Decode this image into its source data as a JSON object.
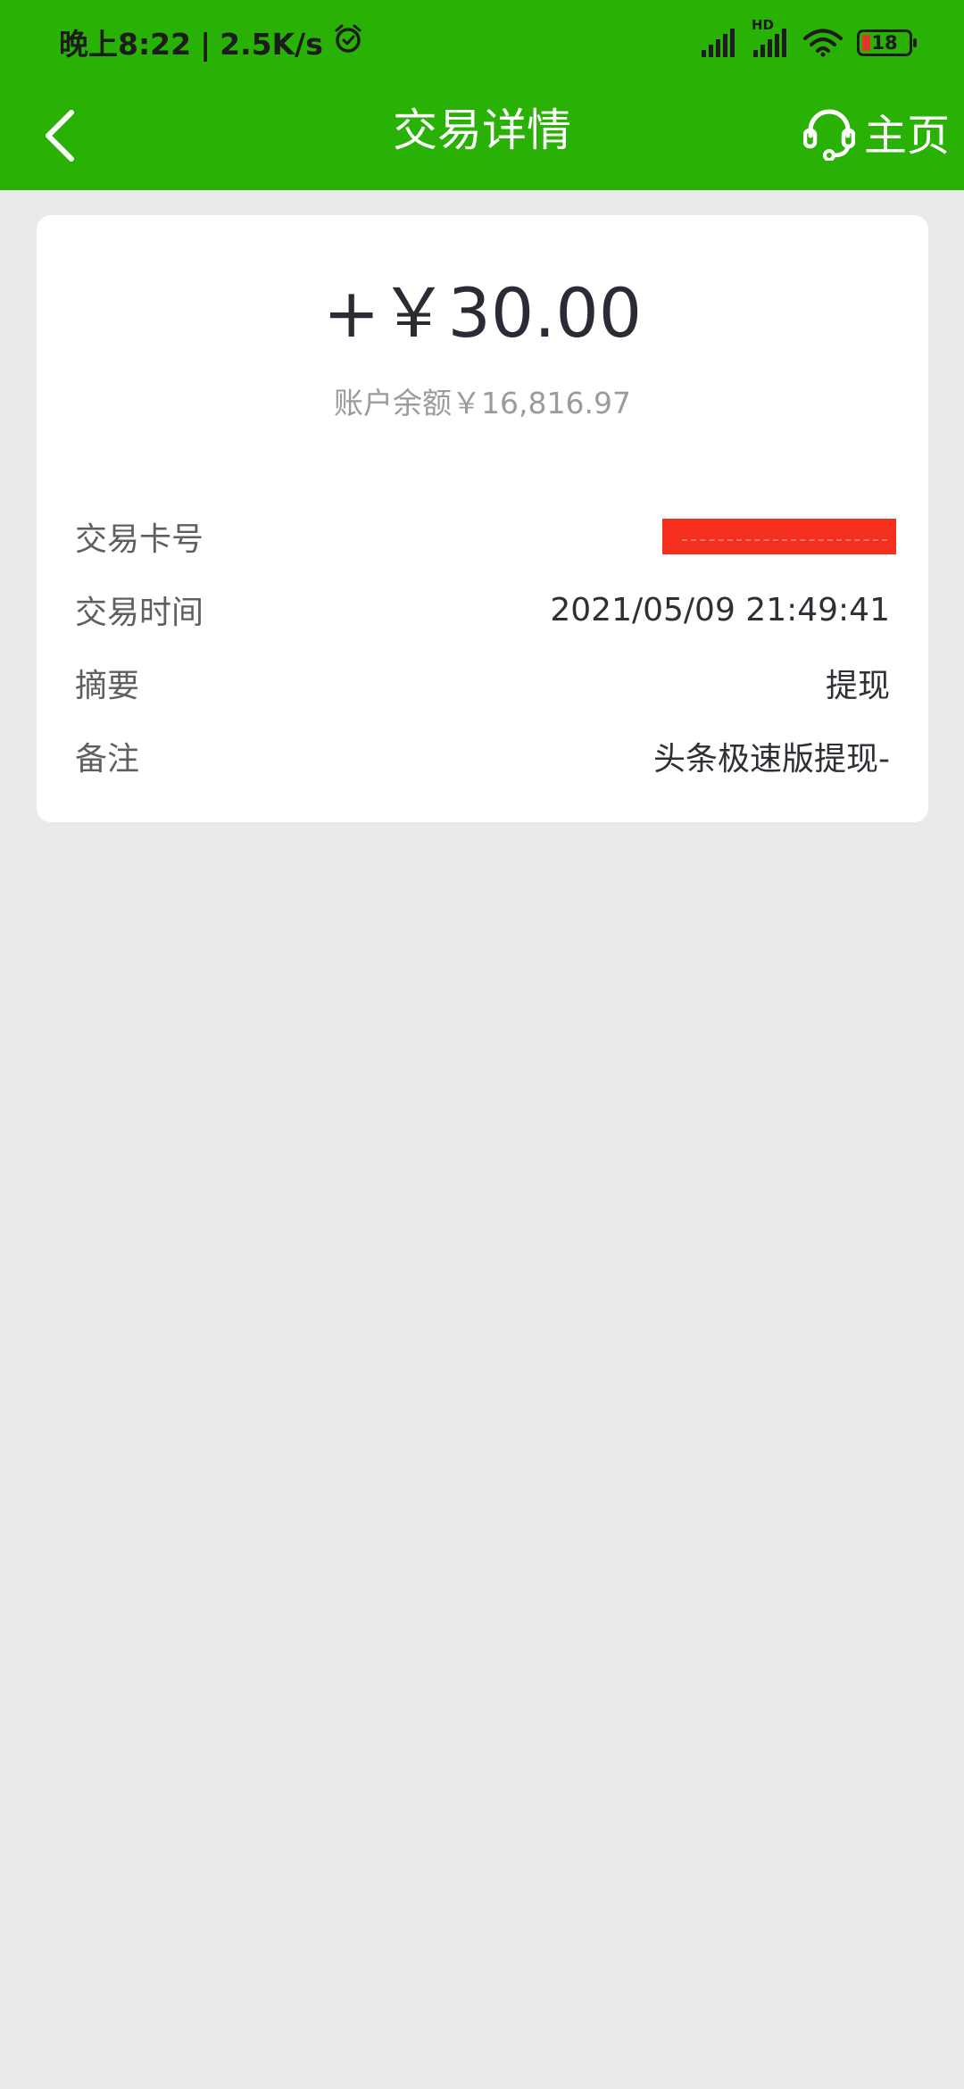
{
  "status_bar": {
    "time": "晚上8:22",
    "separator": "|",
    "network_speed": "2.5K/s",
    "alarm_icon": "alarm-clock-icon",
    "signal_icon": "cell-signal-icon",
    "signal_hd_label": "HD",
    "wifi_icon": "wifi-icon",
    "battery_level": "18",
    "battery_color": "#e9322b"
  },
  "nav": {
    "title": "交易详情",
    "back_icon": "chevron-left-icon",
    "service_icon": "headset-icon",
    "home_label": "主页",
    "background_color": "#29b106"
  },
  "transaction": {
    "amount": "+￥30.00",
    "balance": "账户余额￥16,816.97",
    "details": [
      {
        "label": "交易卡号",
        "value": ""
      },
      {
        "label": "交易时间",
        "value": "2021/05/09 21:49:41"
      },
      {
        "label": "摘要",
        "value": "提现"
      },
      {
        "label": "备注",
        "value": "头条极速版提现-"
      }
    ],
    "redaction_color": "#f52f1d"
  }
}
